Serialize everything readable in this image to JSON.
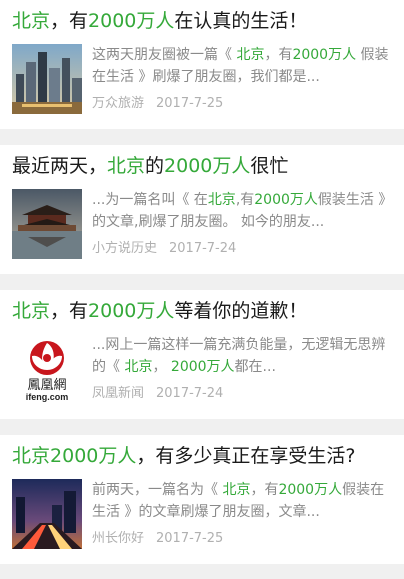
{
  "articles": [
    {
      "title_parts": [
        "",
        "北京",
        "，有",
        "2000万人",
        "在认真的生活！"
      ],
      "snippet_parts": [
        "这两天朋友圈被一篇《 ",
        "北京",
        "，有",
        "2000万人",
        " 假装在生活 》刷爆了朋友圈，我们都是..."
      ],
      "source": "万众旅游",
      "date": "2017-7-25",
      "thumb": "city-skyline-image"
    },
    {
      "title_parts": [
        "最近两天，",
        "北京",
        "的",
        "2000万人",
        "很忙"
      ],
      "snippet_parts": [
        "...为一篇名叫《 在",
        "北京",
        ",有",
        "2000万人",
        "假装生活 》的文章,刷爆了朋友圈。 如今的朋友..."
      ],
      "source": "小方说历史",
      "date": "2017-7-24",
      "thumb": "forbidden-city-image"
    },
    {
      "title_parts": [
        "",
        "北京",
        "，有",
        "2000万人",
        "等着你的道歉！"
      ],
      "snippet_parts": [
        "...网上一篇这样一篇充满负能量，无逻辑无思辨的《 ",
        "北京",
        "， ",
        "2000万人",
        "都在..."
      ],
      "source": "凤凰新闻",
      "date": "2017-7-24",
      "thumb": "ifeng-logo",
      "logo_text": "鳳凰網",
      "logo_sub": "ifeng.com"
    },
    {
      "title_parts": [
        "",
        "北京",
        "",
        "2000万人",
        "，有多少真正在享受生活?"
      ],
      "snippet_parts": [
        "前两天，一篇名为《 ",
        "北京",
        "，有",
        "2000万人",
        "假装在生活 》的文章刷爆了朋友圈，文章..."
      ],
      "source": "州长你好",
      "date": "2017-7-25",
      "thumb": "night-traffic-image"
    }
  ],
  "colors": {
    "highlight": "#35a93a",
    "text": "#1a1a1a",
    "muted": "#8a8a8a",
    "logo_red": "#c8161d"
  }
}
